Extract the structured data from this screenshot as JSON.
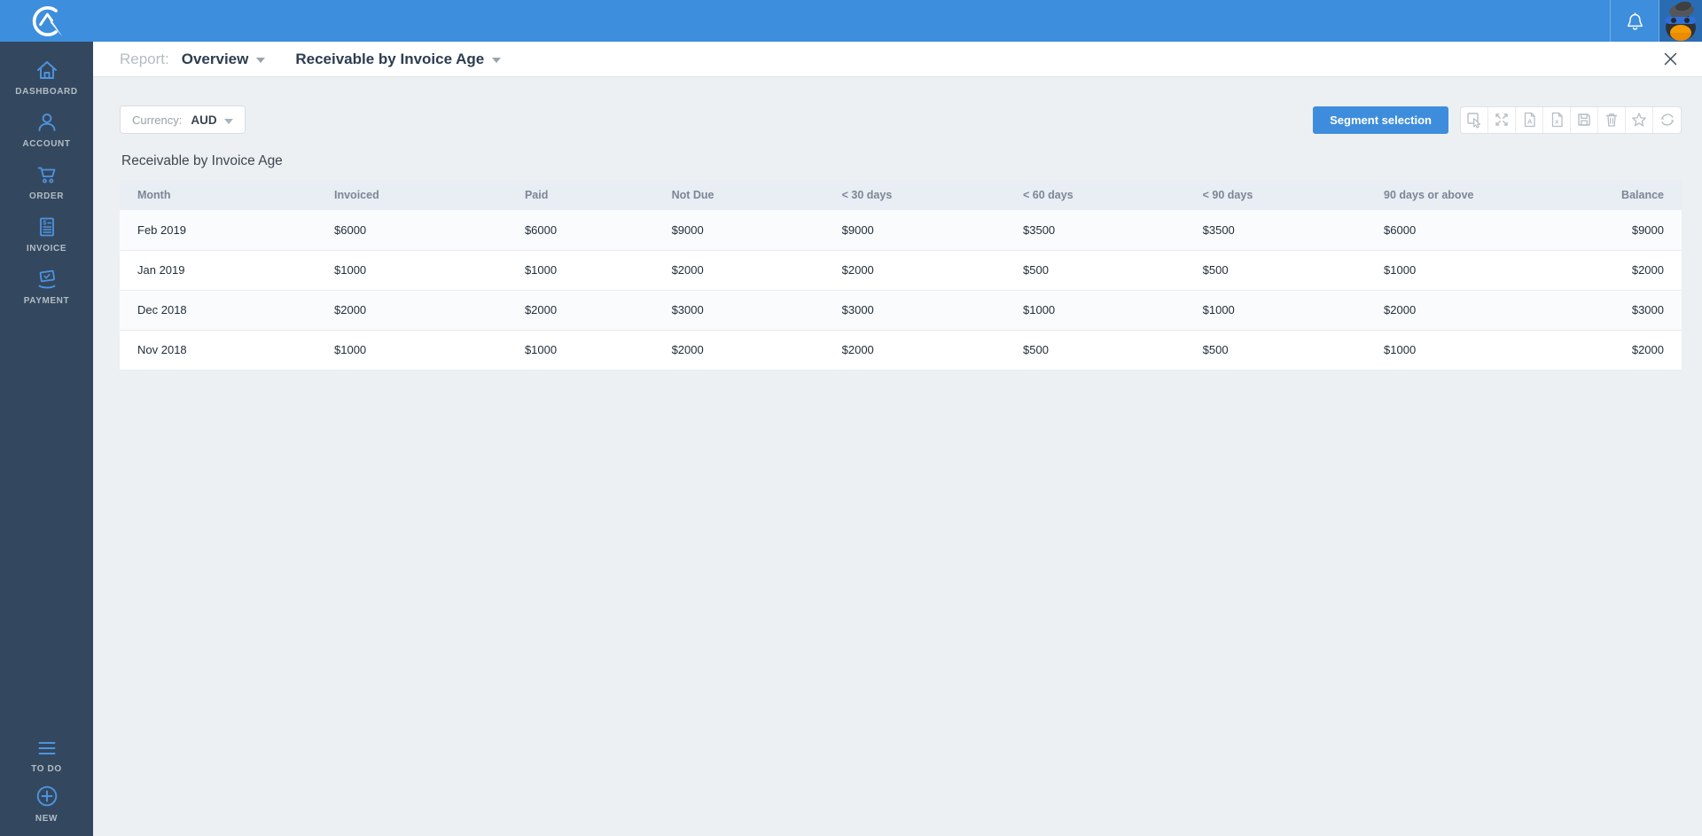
{
  "topbar": {
    "icons": [
      "app-logo",
      "bell-icon",
      "penguin-avatar"
    ]
  },
  "sidebar": {
    "items": [
      {
        "label": "DASHBOARD",
        "icon": "home-icon"
      },
      {
        "label": "ACCOUNT",
        "icon": "person-icon"
      },
      {
        "label": "ORDER",
        "icon": "cart-icon"
      },
      {
        "label": "INVOICE",
        "icon": "invoice-icon"
      },
      {
        "label": "PAYMENT",
        "icon": "payment-icon"
      }
    ],
    "bottom_items": [
      {
        "label": "TO DO",
        "icon": "todo-list-icon"
      },
      {
        "label": "NEW",
        "icon": "plus-circle-icon"
      }
    ]
  },
  "report_header": {
    "label": "Report:",
    "selectors": [
      {
        "value": "Overview"
      },
      {
        "value": "Receivable by Invoice Age"
      }
    ],
    "close_icon": "close-icon"
  },
  "controls": {
    "currency_label": "Currency:",
    "currency_value": "AUD",
    "segment_button_label": "Segment selection",
    "toolbar_icons": [
      "select-area-icon",
      "expand-icon",
      "export-pdf-icon",
      "export-excel-icon",
      "save-icon",
      "trash-icon",
      "star-icon",
      "refresh-icon"
    ]
  },
  "table": {
    "title": "Receivable by Invoice Age",
    "columns": [
      "Month",
      "Invoiced",
      "Paid",
      "Not Due",
      "< 30 days",
      "< 60 days",
      "< 90 days",
      "90 days or above",
      "Balance"
    ],
    "rows": [
      [
        "Feb 2019",
        "$6000",
        "$6000",
        "$9000",
        "$9000",
        "$3500",
        "$3500",
        "$6000",
        "$9000"
      ],
      [
        "Jan 2019",
        "$1000",
        "$1000",
        "$2000",
        "$2000",
        "$500",
        "$500",
        "$1000",
        "$2000"
      ],
      [
        "Dec 2018",
        "$2000",
        "$2000",
        "$3000",
        "$3000",
        "$1000",
        "$1000",
        "$2000",
        "$3000"
      ],
      [
        "Nov 2018",
        "$1000",
        "$1000",
        "$2000",
        "$2000",
        "$500",
        "$500",
        "$1000",
        "$2000"
      ]
    ]
  },
  "colors": {
    "topbar_blue": "#3d8edd",
    "sidebar_navy": "#33485f",
    "accent_blue": "#4f94de",
    "button_blue": "#3e8ddd",
    "table_header_bg": "#e9edf4",
    "page_bg": "#edf0f2"
  }
}
